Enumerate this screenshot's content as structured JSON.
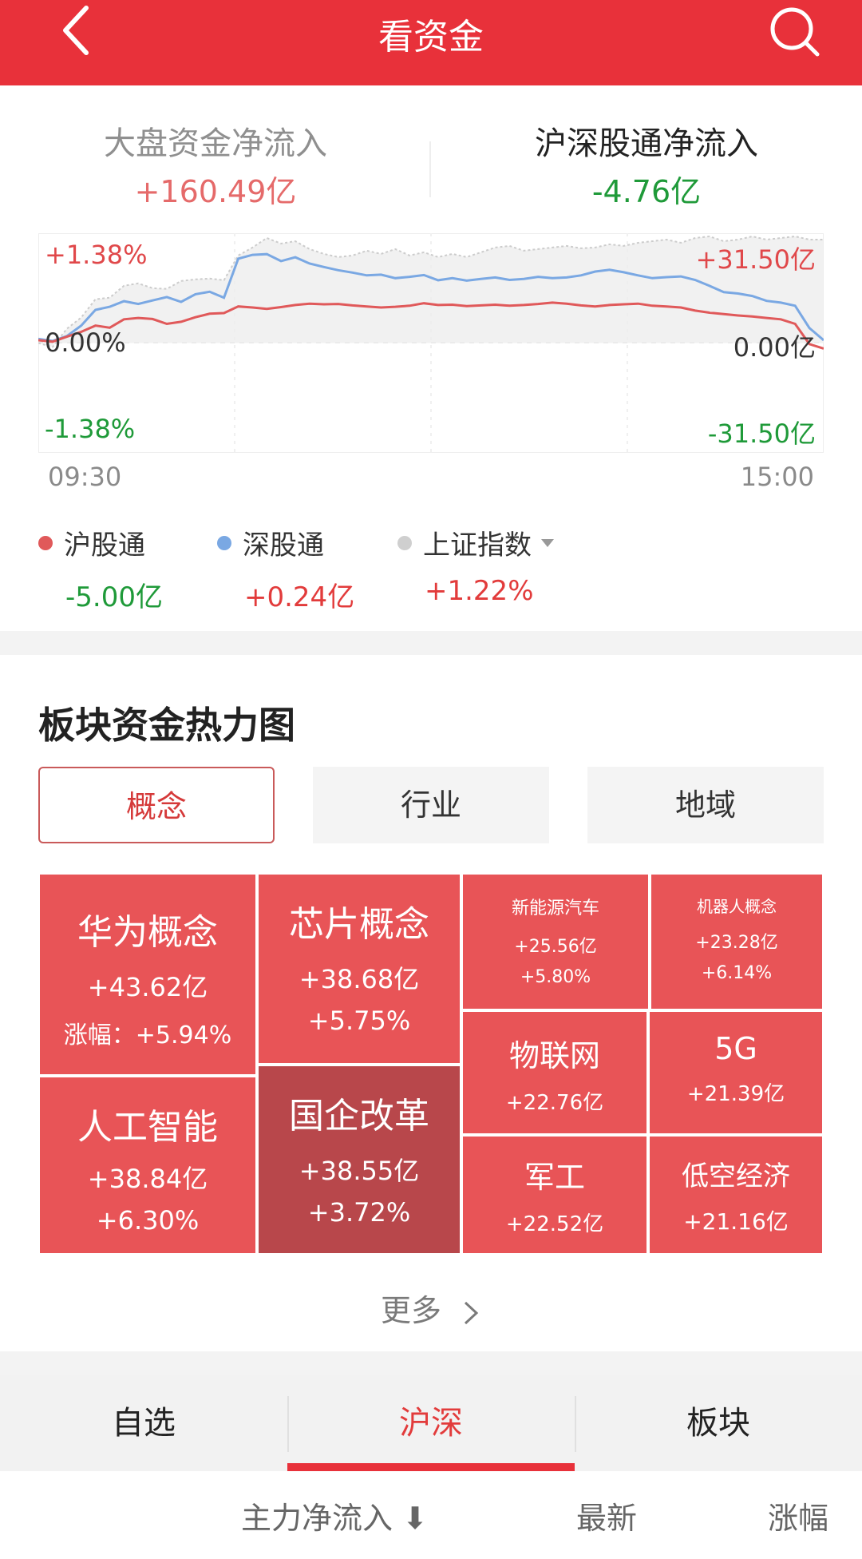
{
  "header": {
    "title": "看资金",
    "back_icon": "chevron-left-icon",
    "search_icon": "search-icon",
    "bg_color": "#e8313a"
  },
  "flow_tabs": [
    {
      "label": "大盘资金净流入",
      "value": "+160.49亿",
      "active": false
    },
    {
      "label": "沪深股通净流入",
      "value": "-4.76亿",
      "active": true
    }
  ],
  "chart_data": {
    "type": "line",
    "x_start": "09:30",
    "x_end": "15:00",
    "y_left_ticks": [
      "+1.38%",
      "0.00%",
      "-1.38%"
    ],
    "y_right_ticks": [
      "+31.50亿",
      "0.00亿",
      "-31.50亿"
    ],
    "y_left_range": [
      -1.38,
      1.38
    ],
    "y_right_range": [
      -31.5,
      31.5
    ],
    "n_points_full_day": 241,
    "series": [
      {
        "name": "沪股通",
        "color": "#e0595a",
        "values": [
          0.8,
          0.4,
          1.8,
          3.2,
          5.0,
          4.4,
          6.8,
          7.2,
          6.9,
          5.5,
          6.1,
          7.4,
          8.4,
          8.6,
          10.5,
          10.2,
          9.8,
          10.3,
          10.9,
          11.3,
          11.1,
          11.2,
          10.8,
          10.5,
          10.2,
          10.4,
          10.7,
          11.4,
          10.9,
          11.0,
          10.6,
          10.8,
          11.0,
          10.7,
          10.9,
          11.2,
          11.6,
          11.3,
          10.8,
          10.5,
          10.9,
          11.1,
          11.3,
          10.7,
          10.5,
          10.2,
          9.3,
          8.7,
          8.3,
          7.9,
          7.6,
          7.2,
          6.8,
          5.5,
          -0.3,
          -1.6
        ]
      },
      {
        "name": "深股通",
        "color": "#7aa8e3",
        "values": [
          1.2,
          0.6,
          2.0,
          5.0,
          9.5,
          10.4,
          12.0,
          11.2,
          12.2,
          13.2,
          11.8,
          14.0,
          14.7,
          13.0,
          24.2,
          25.3,
          25.5,
          23.5,
          24.6,
          22.8,
          21.8,
          20.9,
          20.2,
          19.4,
          19.6,
          18.6,
          19.0,
          19.5,
          18.0,
          18.6,
          17.9,
          18.4,
          18.8,
          18.1,
          18.4,
          19.0,
          18.6,
          18.8,
          19.4,
          20.5,
          21.0,
          20.3,
          19.4,
          18.6,
          18.9,
          19.1,
          18.1,
          16.4,
          14.6,
          14.2,
          13.5,
          12.1,
          11.6,
          10.7,
          4.3,
          0.8
        ]
      },
      {
        "name": "上证指数",
        "color": "#d8d8d8",
        "values": [
          0.0,
          -0.05,
          0.18,
          0.32,
          0.55,
          0.57,
          0.72,
          0.75,
          0.69,
          0.68,
          0.78,
          0.8,
          0.81,
          0.79,
          1.1,
          1.2,
          1.32,
          1.25,
          1.28,
          1.18,
          1.12,
          1.08,
          1.1,
          1.16,
          1.12,
          1.18,
          1.1,
          1.14,
          1.08,
          1.12,
          1.08,
          1.14,
          1.2,
          1.22,
          1.16,
          1.18,
          1.2,
          1.22,
          1.19,
          1.2,
          1.24,
          1.22,
          1.26,
          1.28,
          1.3,
          1.26,
          1.32,
          1.34,
          1.28,
          1.3,
          1.34,
          1.3,
          1.32,
          1.34,
          1.3,
          1.3
        ]
      }
    ]
  },
  "legend": [
    {
      "name": "沪股通",
      "value": "-5.00亿",
      "color": "#e0595a",
      "value_color": "#1f9a39"
    },
    {
      "name": "深股通",
      "value": "+0.24亿",
      "color": "#7aa8e3",
      "value_color": "#e23b3b"
    },
    {
      "name": "上证指数",
      "value": "+1.22%",
      "color": "#cfcfcf",
      "value_color": "#e23b3b",
      "has_dropdown": true
    }
  ],
  "heatmap_section": {
    "title": "板块资金热力图",
    "segments": [
      {
        "label": "概念",
        "active": true
      },
      {
        "label": "行业",
        "active": false
      },
      {
        "label": "地域",
        "active": false
      }
    ],
    "cells": [
      {
        "name": "华为概念",
        "amount": "+43.62亿",
        "pct": "涨幅：+5.94%"
      },
      {
        "name": "人工智能",
        "amount": "+38.84亿",
        "pct": "+6.30%"
      },
      {
        "name": "芯片概念",
        "amount": "+38.68亿",
        "pct": "+5.75%"
      },
      {
        "name": "国企改革",
        "amount": "+38.55亿",
        "pct": "+3.72%"
      },
      {
        "name": "新能源汽车",
        "amount": "+25.56亿",
        "pct": "+5.80%"
      },
      {
        "name": "机器人概念",
        "amount": "+23.28亿",
        "pct": "+6.14%"
      },
      {
        "name": "物联网",
        "amount": "+22.76亿"
      },
      {
        "name": "5G",
        "amount": "+21.39亿"
      },
      {
        "name": "军工",
        "amount": "+22.52亿"
      },
      {
        "name": "低空经济",
        "amount": "+21.16亿"
      }
    ],
    "more_label": "更多"
  },
  "bottom_tabs": [
    {
      "label": "自选",
      "active": false
    },
    {
      "label": "沪深",
      "active": true
    },
    {
      "label": "板块",
      "active": false
    }
  ],
  "sort_bar": [
    {
      "label": "主力净流入 ⬇"
    },
    {
      "label": "最新"
    },
    {
      "label": "涨幅"
    }
  ]
}
